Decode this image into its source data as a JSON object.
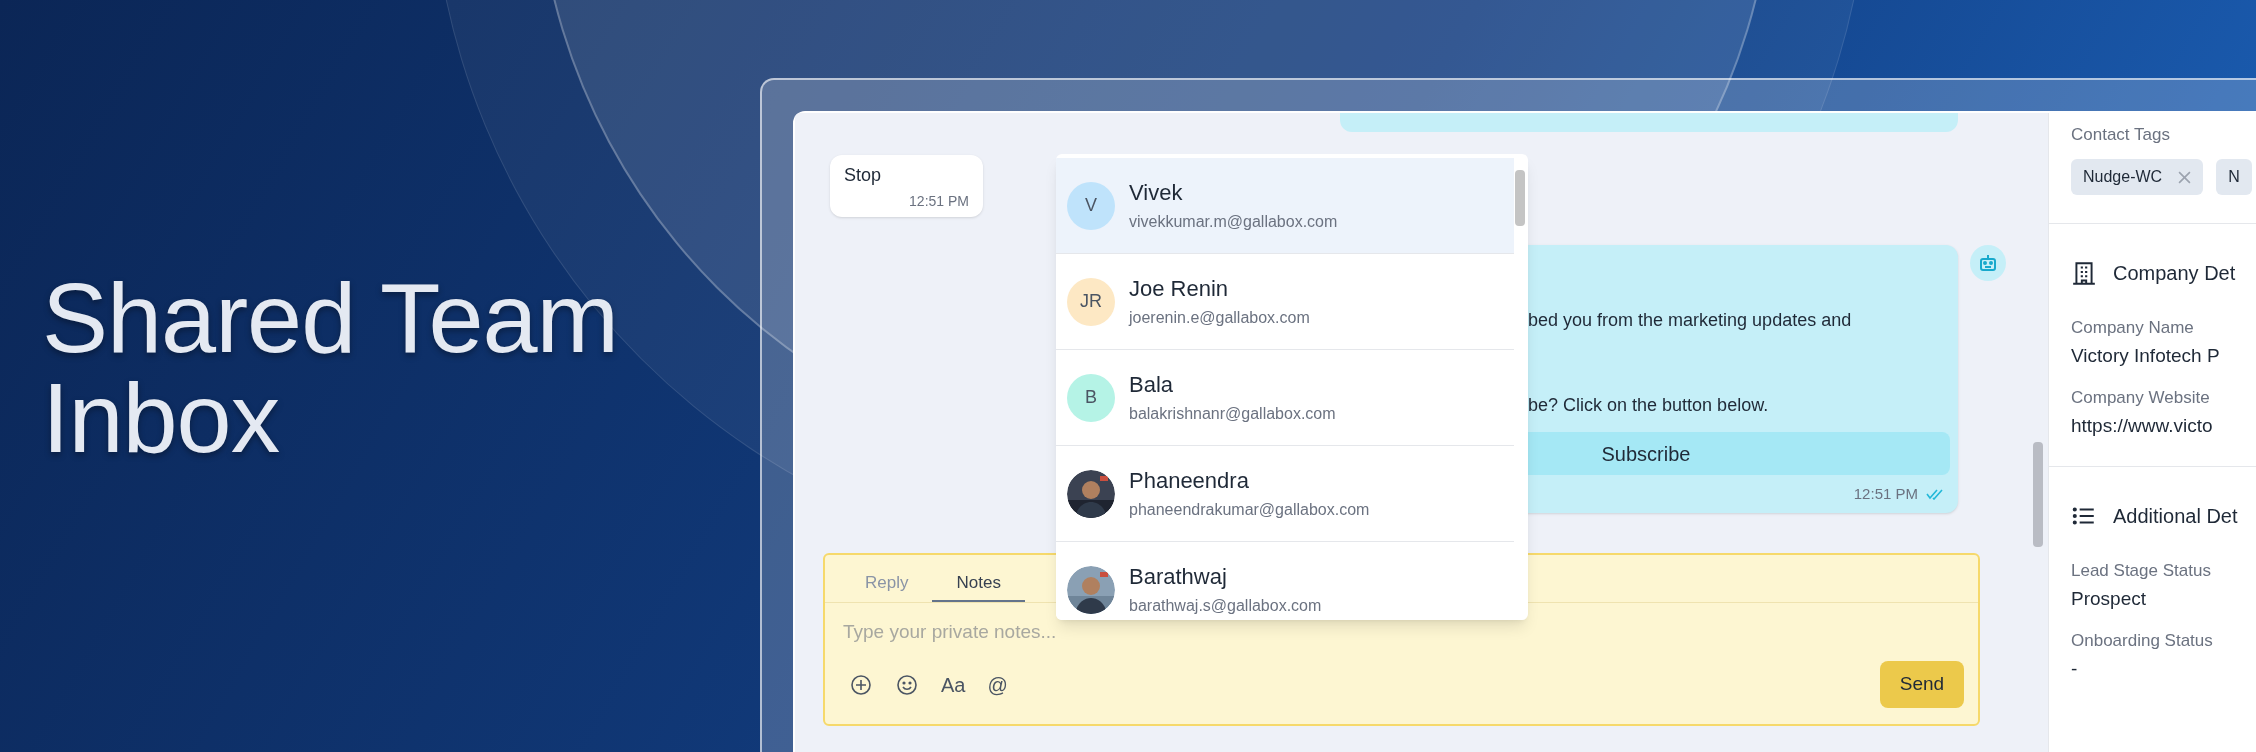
{
  "headline": "Shared Team Inbox",
  "chat": {
    "messages": [
      {
        "kind": "incoming",
        "text": "Stop",
        "time": "12:51 PM"
      },
      {
        "kind": "bot",
        "lines": [
          "bed you from the marketing updates and",
          "be? Click on the button below."
        ],
        "button": "Subscribe",
        "time": "12:51 PM",
        "read": true
      }
    ]
  },
  "mention_dropdown": {
    "items": [
      {
        "kind": "initials",
        "initials": "V",
        "color": "#bfe3fb",
        "name": "Vivek",
        "email": "vivekkumar.m@gallabox.com",
        "selected": true
      },
      {
        "kind": "initials",
        "initials": "JR",
        "color": "#fde8c4",
        "name": "Joe Renin",
        "email": "joerenin.e@gallabox.com",
        "selected": false
      },
      {
        "kind": "initials",
        "initials": "B",
        "color": "#b5f3e6",
        "name": "Bala",
        "email": "balakrishnanr@gallabox.com",
        "selected": false
      },
      {
        "name": "Phaneendra",
        "email": "phaneendrakumar@gallabox.com",
        "selected": false
      },
      {
        "name": "Barathwaj",
        "email": "barathwaj.s@gallabox.com",
        "selected": false
      }
    ]
  },
  "composer": {
    "tabs": [
      {
        "label": "Reply",
        "selected": false
      },
      {
        "label": "Notes",
        "selected": true
      }
    ],
    "placeholder": "Type your private notes...",
    "tools": [
      {
        "kind": "add"
      },
      {
        "kind": "emoji"
      },
      {
        "kind": "text",
        "label": "Aa"
      },
      {
        "kind": "text",
        "label": "@"
      }
    ],
    "send": "Send"
  },
  "contact_panel": {
    "tags_label": "Contact Tags",
    "tags": [
      {
        "label": "Nudge-WC",
        "removable": true
      },
      {
        "label": "N",
        "removable": false
      }
    ],
    "sections": [
      {
        "kind": "company",
        "title": "Company Det",
        "fields": [
          {
            "label": "Company Name",
            "value": "Victory Infotech P"
          },
          {
            "label": "Company Website",
            "value": "https://www.victo"
          }
        ]
      },
      {
        "kind": "list",
        "title": "Additional Det",
        "fields": [
          {
            "label": "Lead Stage Status",
            "value": "Prospect"
          },
          {
            "label": "Onboarding Status",
            "value": "-"
          }
        ]
      }
    ]
  }
}
